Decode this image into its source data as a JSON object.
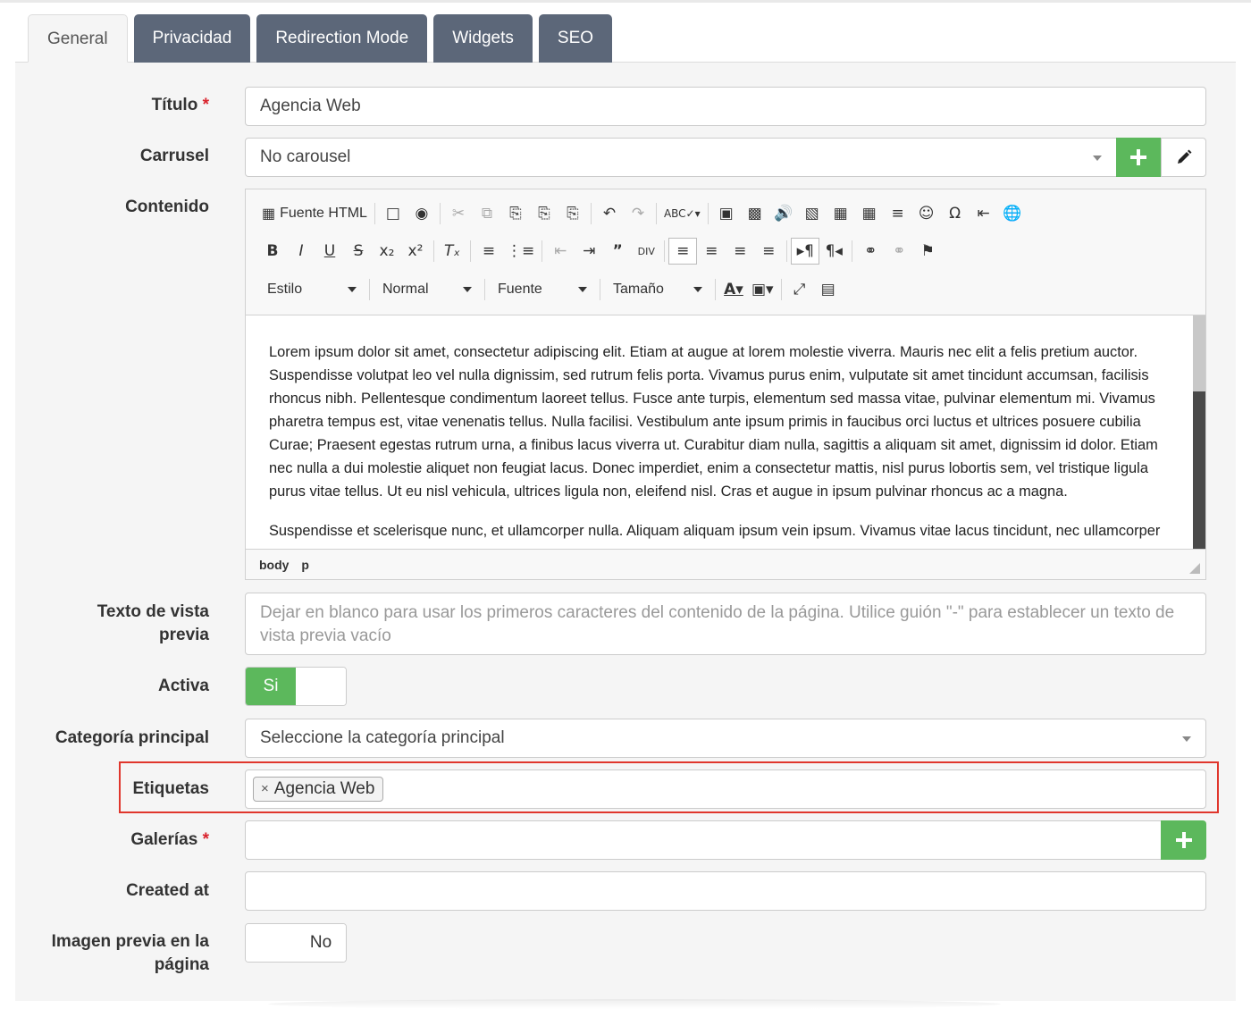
{
  "tabs": [
    {
      "label": "General",
      "active": true
    },
    {
      "label": "Privacidad"
    },
    {
      "label": "Redirection Mode"
    },
    {
      "label": "Widgets"
    },
    {
      "label": "SEO"
    }
  ],
  "form": {
    "titulo": {
      "label": "Título",
      "required": "*",
      "value": "Agencia Web"
    },
    "carrusel": {
      "label": "Carrusel",
      "value": "No carousel",
      "add_icon": "plus-icon",
      "edit_icon": "pencil-icon"
    },
    "contenido": {
      "label": "Contenido"
    },
    "preview_text": {
      "label_line1": "Texto de vista",
      "label_line2": "previa",
      "placeholder": "Dejar en blanco para usar los primeros caracteres del contenido de la página. Utilice guión \"-\" para establecer un texto de vista previa vacío"
    },
    "activa": {
      "label": "Activa",
      "on_label": "Si"
    },
    "categoria": {
      "label": "Categoría principal",
      "placeholder": "Seleccione la categoría principal"
    },
    "etiquetas": {
      "label": "Etiquetas",
      "tags": [
        "Agencia Web"
      ],
      "remove_glyph": "×"
    },
    "galerias": {
      "label": "Galerías",
      "required": "*"
    },
    "created_at": {
      "label": "Created at",
      "value": ""
    },
    "imagen_previa": {
      "label_line1": "Imagen previa en la",
      "label_line2": "página",
      "off_label": "No"
    }
  },
  "editor": {
    "source_button": "Fuente HTML",
    "combos": {
      "style": "Estilo",
      "format": "Normal",
      "font": "Fuente",
      "size": "Tamaño"
    },
    "paragraphs": [
      "Lorem ipsum dolor sit amet, consectetur adipiscing elit. Etiam at augue at lorem molestie viverra. Mauris nec elit a felis pretium auctor. Suspendisse volutpat leo vel nulla dignissim, sed rutrum felis porta. Vivamus purus enim, vulputate sit amet tincidunt accumsan, facilisis rhoncus nibh. Pellentesque condimentum laoreet tellus. Fusce ante turpis, elementum sed massa vitae, pulvinar elementum mi. Vivamus pharetra tempus est, vitae venenatis tellus. Nulla facilisi. Vestibulum ante ipsum primis in faucibus orci luctus et ultrices posuere cubilia Curae; Praesent egestas rutrum urna, a finibus lacus viverra ut. Curabitur diam nulla, sagittis a aliquam sit amet, dignissim id dolor. Etiam nec nulla a dui molestie aliquet non feugiat lacus. Donec imperdiet, enim a consectetur mattis, nisl purus lobortis sem, vel tristique ligula purus vitae tellus. Ut eu nisl vehicula, ultrices ligula non, eleifend nisl. Cras et augue in ipsum pulvinar rhoncus ac a magna.",
      "Suspendisse et scelerisque nunc, et ullamcorper nulla. Aliquam aliquam ipsum vein ipsum. Vivamus vitae lacus tincidunt, nec ullamcorper"
    ],
    "path": [
      "body",
      "p"
    ]
  },
  "colors": {
    "tab_bg": "#5c6779",
    "green": "#5cb85c",
    "highlight": "#e0362c",
    "required": "#d9232d"
  }
}
